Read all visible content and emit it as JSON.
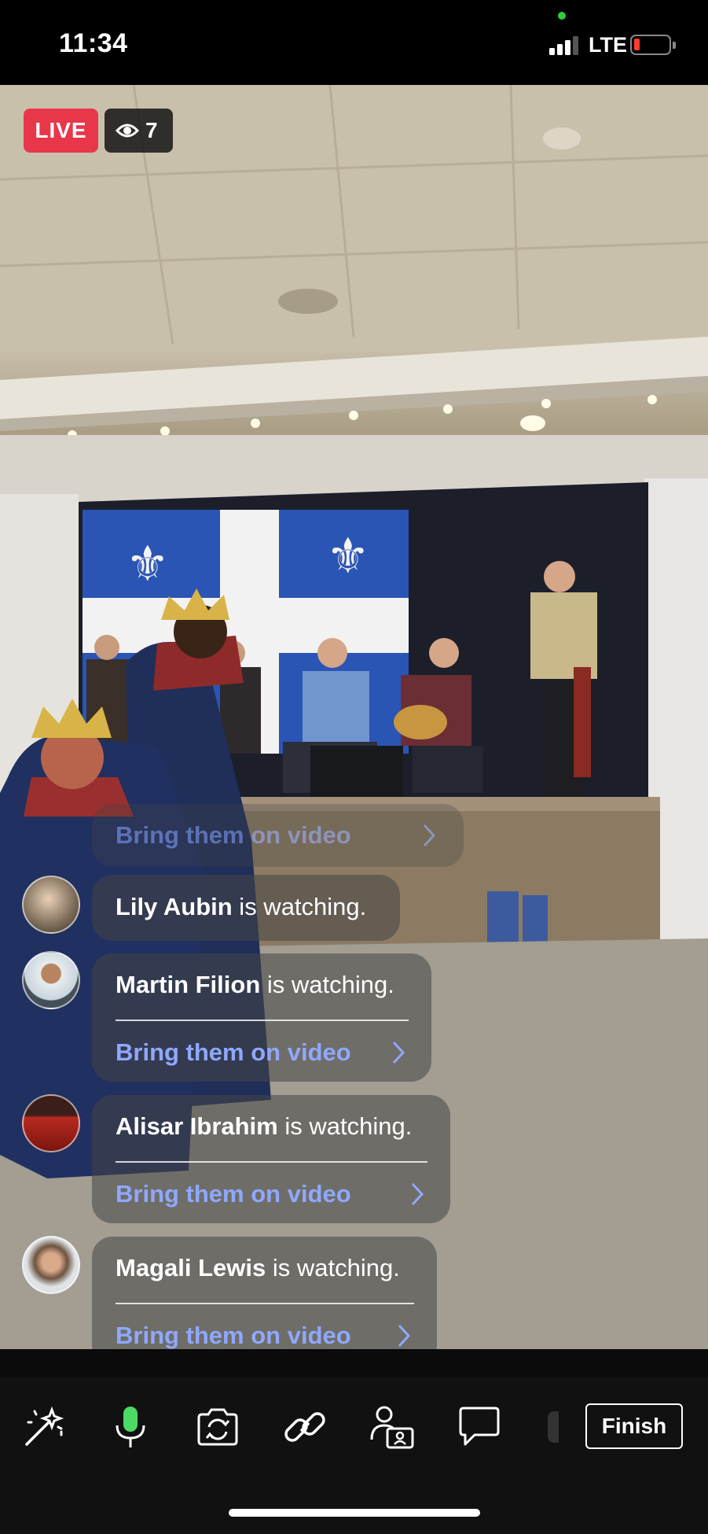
{
  "status_bar": {
    "time": "11:34",
    "network": "LTE",
    "battery_level": 0.1
  },
  "stream": {
    "live_label": "LIVE",
    "viewer_count": "7",
    "eye_icon": "eye-icon"
  },
  "comments": [
    {
      "name": "",
      "suffix": "",
      "link": "Bring them on video",
      "partial": true
    },
    {
      "name": "Lily Aubin",
      "suffix": " is watching.",
      "link": ""
    },
    {
      "name": "Martin Filion",
      "suffix": " is watching.",
      "link": "Bring them on video"
    },
    {
      "name": "Alisar Ibrahim",
      "suffix": " is watching.",
      "link": "Bring them on video"
    },
    {
      "name": "Magali Lewis",
      "suffix": " is watching.",
      "link": "Bring them on video"
    }
  ],
  "toolbar": {
    "icons": [
      "magic-wand-icon",
      "microphone-icon",
      "flip-camera-icon",
      "link-icon",
      "guest-icon",
      "comment-icon"
    ],
    "finish_label": "Finish"
  },
  "colors": {
    "live_red": "#e8374a",
    "link_blue": "#8fa8ff",
    "mic_green": "#4cd964"
  }
}
